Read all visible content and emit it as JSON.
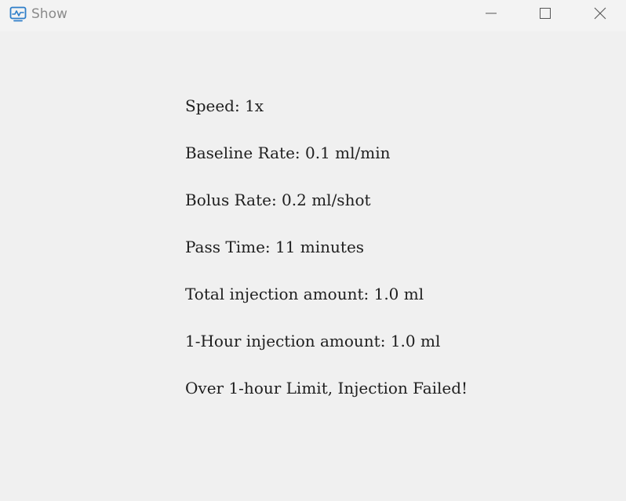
{
  "window": {
    "title": "Show",
    "app_icon": "monitor-chart-icon",
    "controls": {
      "minimize_icon": "minimize-icon",
      "maximize_icon": "maximize-icon",
      "close_icon": "close-icon"
    },
    "accent_color": "#2e7ec9"
  },
  "info": {
    "speed": "Speed: 1x",
    "baseline_rate": "Baseline Rate: 0.1 ml/min",
    "bolus_rate": "Bolus Rate: 0.2 ml/shot",
    "pass_time": "Pass Time: 11 minutes",
    "total_injection": "Total injection amount: 1.0 ml",
    "hour_injection": "1-Hour injection amount: 1.0 ml",
    "status_message": "Over 1-hour Limit, Injection Failed!"
  }
}
